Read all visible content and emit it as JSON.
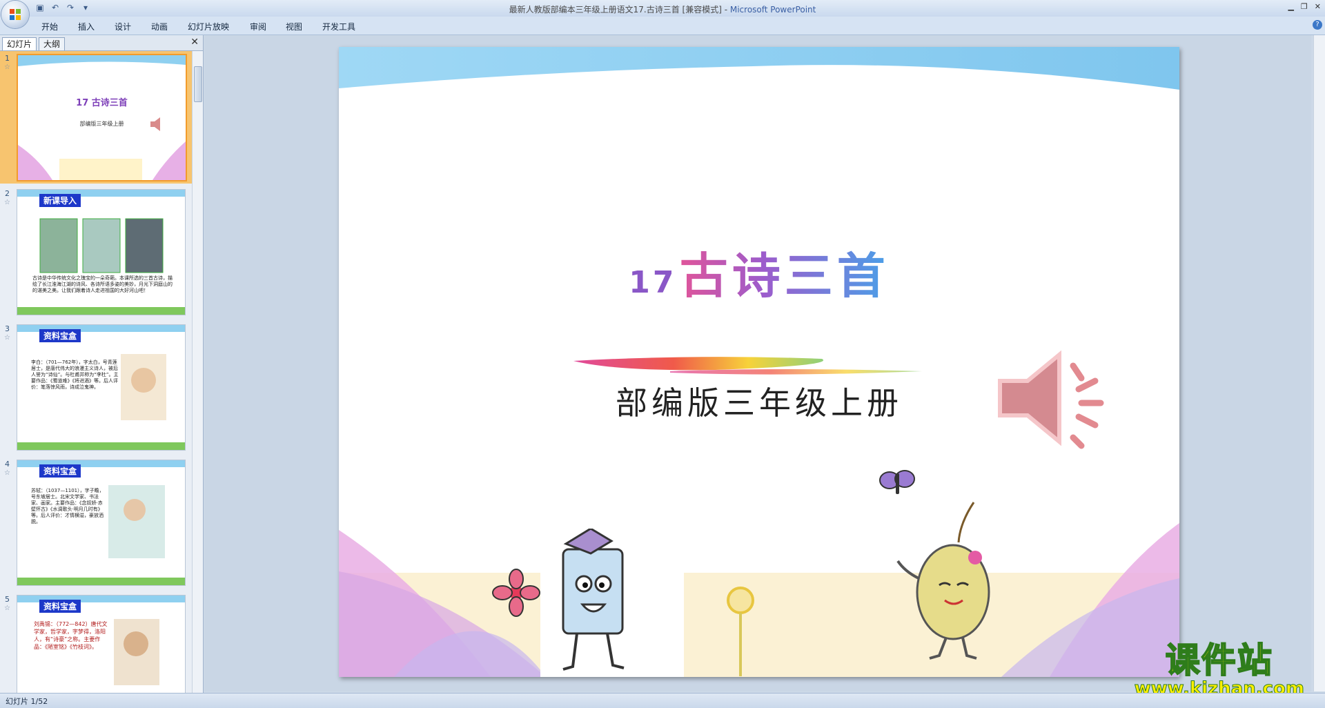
{
  "window": {
    "title": "最新人教版部编本三年级上册语文17.古诗三首 [兼容模式]",
    "app_name": "Microsoft PowerPoint",
    "separator": " - "
  },
  "ribbon": {
    "tabs": [
      "开始",
      "插入",
      "设计",
      "动画",
      "幻灯片放映",
      "审阅",
      "视图",
      "开发工具"
    ]
  },
  "left_pane": {
    "tab_slides": "幻灯片",
    "tab_outline": "大纲",
    "close_glyph": "✕"
  },
  "thumbnails": [
    {
      "num": "1",
      "title_num": "17",
      "title": "古诗三首",
      "subtitle": "部编版三年级上册"
    },
    {
      "num": "2",
      "tag": "新课导入",
      "body": "古诗是中华传统文化之瑰宝的一朵奇葩。本课所选的三首古诗，描绘了长江淮海江湖的诗风、各诗所语多姿的美妙，月光下洞庭山的的湛美之美。让我们跟着诗人走进祖国的大好河山吧！"
    },
    {
      "num": "3",
      "tag": "资料宝盒",
      "body": "李白：（701—762年），字太白，号青莲居士，是唐代伟大的浪漫主义诗人，被后人誉为“诗仙”。与杜甫并称为“李杜”。主要作品：《蜀道难》《将进酒》等。后人评价：笔落惊风雨，诗成泣鬼神。"
    },
    {
      "num": "4",
      "tag": "资料宝盒",
      "body": "苏轼：（1037—1101），字子瞻，号东坡居士。北宋文学家、书法家、画家。主要作品：《念奴娇·赤壁怀古》《水调歌头·明月几时有》等。后人评价：才情横溢，豪放洒脱。"
    },
    {
      "num": "5",
      "tag": "资料宝盒",
      "body": "刘禹锡：（772—842）唐代文学家，哲学家，字梦得，洛阳人，有“诗豪”之称。主要作品：《陋室铭》《竹枝词》。"
    }
  ],
  "slide": {
    "number": "17",
    "title": "古诗三首",
    "subtitle": "部编版三年级上册"
  },
  "status": {
    "text": "幻灯片 1/52"
  },
  "watermark": {
    "line1": "课件站",
    "line2": "www.kjzhan.com"
  },
  "colors": {
    "ribbon_bg": "#d6e3f3",
    "selected_thumb": "#f7c46f",
    "title_gradient_start": "#e0559a",
    "title_gradient_end": "#4aa0e8",
    "watermark_yellow": "#fff000",
    "watermark_green": "#2e7d1b"
  },
  "icons": [
    "office-button-icon",
    "save-icon",
    "undo-icon",
    "redo-icon",
    "customize-icon",
    "minimize-icon",
    "restore-icon",
    "close-icon",
    "help-icon",
    "speaker-icon"
  ]
}
